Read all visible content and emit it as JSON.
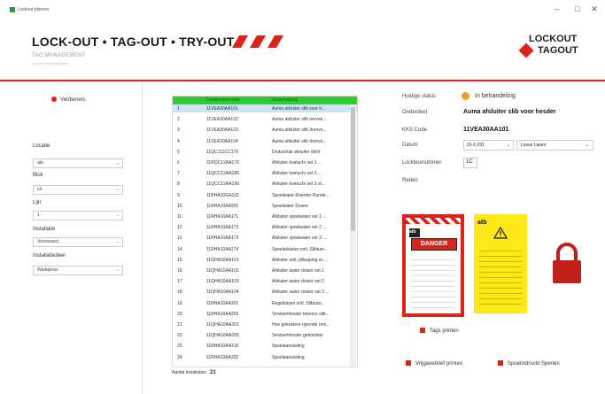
{
  "window": {
    "title": "Lockout planner",
    "minimize": "–",
    "maximize": "□",
    "close": "✕"
  },
  "header": {
    "title": "LOCK-OUT • TAG-OUT • TRY-OUT",
    "subtitle": "TAG MANAGEMENT",
    "subtitle2": "Versie Kentekenbeheer",
    "logo_line1": "LOCKOUT",
    "logo_line2": "TAGOUT"
  },
  "filters": {
    "reset_label": "Verdieners",
    "fields": [
      {
        "label": "Locatie",
        "value": "ato"
      },
      {
        "label": "Blok",
        "value": "cit"
      },
      {
        "label": "Lijn",
        "value": "1"
      },
      {
        "label": "Installatie",
        "value": "Voorwaard"
      },
      {
        "label": "Installatiedeel",
        "value": "Wadaproa"
      }
    ]
  },
  "grid": {
    "headers": [
      "",
      "Component code",
      "Omschrijving"
    ],
    "rows": [
      [
        "1",
        "11VEA30AA101",
        "Auma afsluiter slib voor h..."
      ],
      [
        "2",
        "11VEA30AA102",
        "Auma afsluiter slib toevoe..."
      ],
      [
        "3",
        "11VEA30AA103",
        "Auma afsluiter slib doorvo..."
      ],
      [
        "4",
        "11VEA30AA104",
        "Auma afsluiter slib doorvo..."
      ],
      [
        "5",
        "11QCJ11CC170",
        "Drukschak afsluiter dicht"
      ],
      [
        "6",
        "11RQC12AA170",
        "Afsluiter koeluchr set 1 ..."
      ],
      [
        "7",
        "11QCC12AA180",
        "Afsluiter koeluchr set 2 ..."
      ],
      [
        "8",
        "11QCC12AA190",
        "Afsluiter koeluchr set 3 st..."
      ],
      [
        "9",
        "11RHA10GA101",
        "Spoelwater Roerder Runde..."
      ],
      [
        "10",
        "11RHA10AA501",
        "Spoelwater Dosee"
      ],
      [
        "11",
        "11RHA10AA171",
        "Afsluiter spoelwater set 1 ..."
      ],
      [
        "12",
        "11RHA10AA172",
        "Afsluiter spoelwater set 2 ..."
      ],
      [
        "13",
        "11RHA10AA173",
        "Afsluiter spoelwater set 3 ..."
      ],
      [
        "14",
        "11RHA10AA174",
        "Spoelafsluiter ontl. Slibtuin..."
      ],
      [
        "15",
        "11QHA10AA101",
        "Afsluiter ontl. pilleaping sc..."
      ],
      [
        "16",
        "11QHA10AA102",
        "Afsluiter water doiser set 1"
      ],
      [
        "17",
        "11QHA10AA103",
        "Afsluiter water doiser set 2"
      ],
      [
        "18",
        "11QHA10AA104",
        "Afsluiter water doiser set 3 ..."
      ],
      [
        "19",
        "11RHA10AA201",
        "Regelklepel ontl. Slibtuisi..."
      ],
      [
        "20",
        "11RHA10AA202",
        "Verwarmhoster tekeere slib..."
      ],
      [
        "21",
        "11QHA10AA201",
        "Hoe gekoelere rijzende roni..."
      ],
      [
        "22",
        "11QHA10AA205",
        "Verwarmhoster gekoelstel"
      ],
      [
        "23",
        "11RHA10AA210",
        "Spoelaansluiting"
      ],
      [
        "24",
        "11RHA10AA220",
        "Spoelaansluiting"
      ]
    ],
    "selected_index": 0,
    "count_label": "Aantal installaties",
    "count_value": "23"
  },
  "detail": {
    "status_label": "Huidige status",
    "status_value": "In behandeling",
    "item_label": "Onderdeel",
    "item_value": "Auma afsluiter slib voor hesder",
    "kks_label": "KKS Code",
    "kks_value": "11VEA30AA101",
    "date_label": "Datum",
    "date_value": "21-1-201",
    "date_select": "Lasse Lasen",
    "lock_label": "Lockboxnummer",
    "lock_value": "1C",
    "reason_label": "Reden"
  },
  "actions": {
    "print_tags": "Tags printen",
    "release_request": "Vrijgavebrief printen",
    "print_lockout": "Spoelindruckt Spenen"
  },
  "tags": {
    "tag1_text": "DANGER",
    "tag2_logo": "atb",
    "tag_logo": "atb"
  },
  "colors": {
    "accent": "#d9241c",
    "grid_header": "#2ecc2e",
    "selection": "#cfe3f7",
    "tag_yellow": "#ffe81a"
  }
}
